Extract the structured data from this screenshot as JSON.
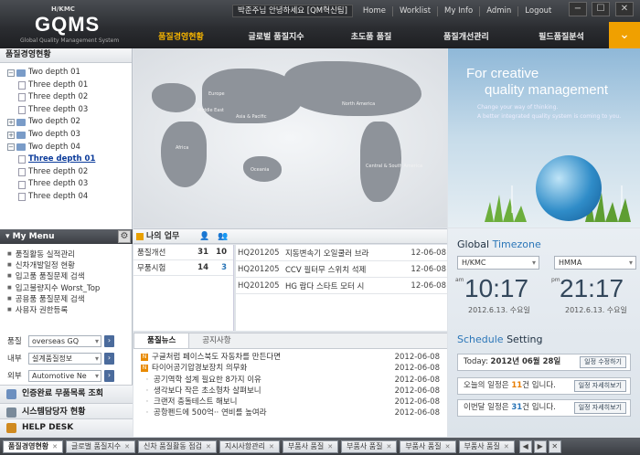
{
  "header": {
    "brand_tag": "H/KMC",
    "logo": "GQMS",
    "logo_sub": "Global Quality Management System",
    "greeting": "박준주님 안녕하세요 [QM혁신팀]",
    "links": [
      "Home",
      "Worklist",
      "My Info",
      "Admin",
      "Logout"
    ],
    "nav": [
      "품질경영현황",
      "글로벌 품질지수",
      "초도품 품질",
      "품질개선관리",
      "필드품질분석"
    ]
  },
  "sidebar": {
    "title": "품질경영현황",
    "tree": [
      {
        "label": "Two depth 01",
        "level": 1,
        "toggle": "-"
      },
      {
        "label": "Three depth 01",
        "level": 2
      },
      {
        "label": "Three depth 02",
        "level": 2
      },
      {
        "label": "Three depth 03",
        "level": 2
      },
      {
        "label": "Two depth 02",
        "level": 1,
        "toggle": "+"
      },
      {
        "label": "Two depth 03",
        "level": 1,
        "toggle": "+"
      },
      {
        "label": "Two depth 04",
        "level": 1,
        "toggle": "-"
      },
      {
        "label": "Three depth 01",
        "level": 2,
        "selected": true
      },
      {
        "label": "Three depth 02",
        "level": 2
      },
      {
        "label": "Three depth 03",
        "level": 2
      },
      {
        "label": "Three depth 04",
        "level": 2
      }
    ],
    "my_menu_title": "My Menu",
    "my_menu": [
      "품질활동 실적관리",
      "신차개발일정 현황",
      "입고품 품질문제 검색",
      "입고불량지수 Worst_Top",
      "공용품 품질문제 검색",
      "사용자 권한등록"
    ],
    "filters": [
      {
        "label": "품질",
        "value": "overseas GQ"
      },
      {
        "label": "내부",
        "value": "설계품질정보"
      },
      {
        "label": "외부",
        "value": "Automotive Ne"
      }
    ],
    "bottom_links": [
      "인증완료 무품목록 조회",
      "시스템담당자 현황",
      "HELP DESK"
    ]
  },
  "map_labels": [
    "Europe",
    "Middle East",
    "Asia & Pacific",
    "Africa",
    "Oceania",
    "North America",
    "Central & South America"
  ],
  "promo": {
    "line1": "For creative",
    "line2": "quality management",
    "sub1": "Change your way of thinking.",
    "sub2": "A better integrated quality system is coming to you."
  },
  "my_work": {
    "title": "나의 업무",
    "stats": [
      {
        "name": "품질개선",
        "a": "31",
        "b": "10"
      },
      {
        "name": "무품시험",
        "a": "14",
        "b": "3"
      }
    ],
    "tasks": [
      {
        "code": "HQ201205",
        "title": "지동변속기 오일쿨러 브라",
        "date": "12-06-08"
      },
      {
        "code": "HQ201205",
        "title": "CCV 필터무 스위치 석제",
        "date": "12-06-08"
      },
      {
        "code": "HQ201205",
        "title": "HG 람다 스타트 모터 시",
        "date": "12-06-08"
      }
    ]
  },
  "news": {
    "tabs": [
      "품질뉴스",
      "공지사항"
    ],
    "items": [
      {
        "title": "구글처럼 페이스북도 자동차를 만든다면",
        "date": "2012-06-08",
        "new": true
      },
      {
        "title": "타이어공기압경보장치 의무화",
        "date": "2012-06-08",
        "new": true
      },
      {
        "title": "공기역학 설계 필요한 8가지 이유",
        "date": "2012-06-08",
        "new": false
      },
      {
        "title": "생각보다 작은 초소형차 살펴보니",
        "date": "2012-06-08",
        "new": false
      },
      {
        "title": "크랜저 충돌테스트 해보니",
        "date": "2012-06-08",
        "new": false
      },
      {
        "title": "공항펜드에 500억·· 연비를 높여라",
        "date": "2012-06-08",
        "new": false
      }
    ]
  },
  "timezone": {
    "title_a": "Global",
    "title_b": "Timezone",
    "zones": [
      {
        "name": "H/KMC",
        "time": "10:17",
        "ampm": "am",
        "date": "2012.6.13. 수요일"
      },
      {
        "name": "HMMA",
        "time": "21:17",
        "ampm": "pm",
        "date": "2012.6.13. 수요일"
      }
    ]
  },
  "schedule": {
    "title_a": "Schedule",
    "title_b": "Setting",
    "today_label": "Today:",
    "today_value": "2012년 06월 28일",
    "today_btn": "일정 수정하기",
    "today_pre": "오늘의 일정은",
    "today_count": "11",
    "today_post": "건 입니다.",
    "week_pre": "이번달 일정은",
    "week_count": "31",
    "week_post": "건 입니다.",
    "detail_btn": "일정 자세히보기"
  },
  "bottom_tabs": [
    "품질경영현황",
    "글로벌 품질지수",
    "신차 품질활동 점검",
    "지시사항관리",
    "부품사 품질",
    "부품사 품질",
    "부품사 품질",
    "부품사 품질"
  ],
  "colors": {
    "accent": "#f0a000",
    "nav_active": "#f5b400",
    "link_blue": "#2b76b8",
    "count_orange": "#e87d00"
  }
}
